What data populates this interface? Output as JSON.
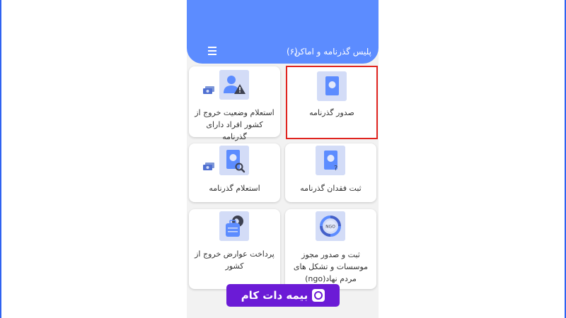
{
  "colors": {
    "header": "#5c8cff",
    "card_background": "#ffffff",
    "icon_background": "#d3dcf7",
    "icon_primary": "#5c8cff",
    "selection_border": "#e0241f",
    "watermark": "#6b1bd6"
  },
  "header": {
    "title": "پلیس گذرنامه و اماکن",
    "count": "(۶)",
    "menu_icon": "list-icon"
  },
  "services": [
    {
      "label": "صدور گذرنامه",
      "icon": "passport-icon",
      "selected": true
    },
    {
      "label": "استعلام وضعیت خروج از کشور افراد دارای گذرنامه",
      "icon": "user-warning-icon",
      "payment_icon": "cash-icon"
    },
    {
      "label": "ثبت فقدان گذرنامه",
      "icon": "passport-question-icon"
    },
    {
      "label": "استعلام گذرنامه",
      "icon": "passport-search-icon",
      "payment_icon": "cash-icon"
    },
    {
      "label": "ثبت و صدور مجوز موسسات و تشکل های مردم نهاد(ngo)",
      "icon": "ngo-icon"
    },
    {
      "label": "پرداخت عوارض خروج از کشور",
      "icon": "luggage-globe-icon"
    }
  ],
  "ngo_icon_text": "NGO",
  "watermark": {
    "text": "بیمه دات کام",
    "logo": "bimeh-logo-icon"
  }
}
